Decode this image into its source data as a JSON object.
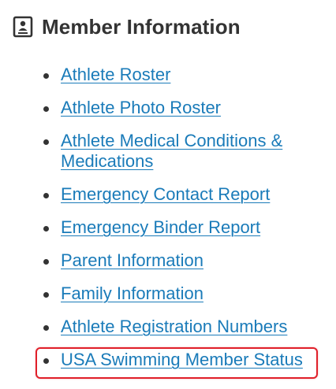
{
  "section": {
    "title": "Member Information",
    "icon": "contact-card-icon"
  },
  "links": [
    {
      "label": "Athlete Roster"
    },
    {
      "label": "Athlete Photo Roster"
    },
    {
      "label": "Athlete Medical Conditions & Medications"
    },
    {
      "label": "Emergency Contact Report"
    },
    {
      "label": "Emergency Binder Report"
    },
    {
      "label": "Parent Information"
    },
    {
      "label": "Family Information"
    },
    {
      "label": "Athlete Registration Numbers"
    },
    {
      "label": "USA Swimming Member Status",
      "highlighted": true
    }
  ],
  "colors": {
    "link": "#1a7bb9",
    "title": "#333333",
    "highlight_border": "#e0202a"
  }
}
